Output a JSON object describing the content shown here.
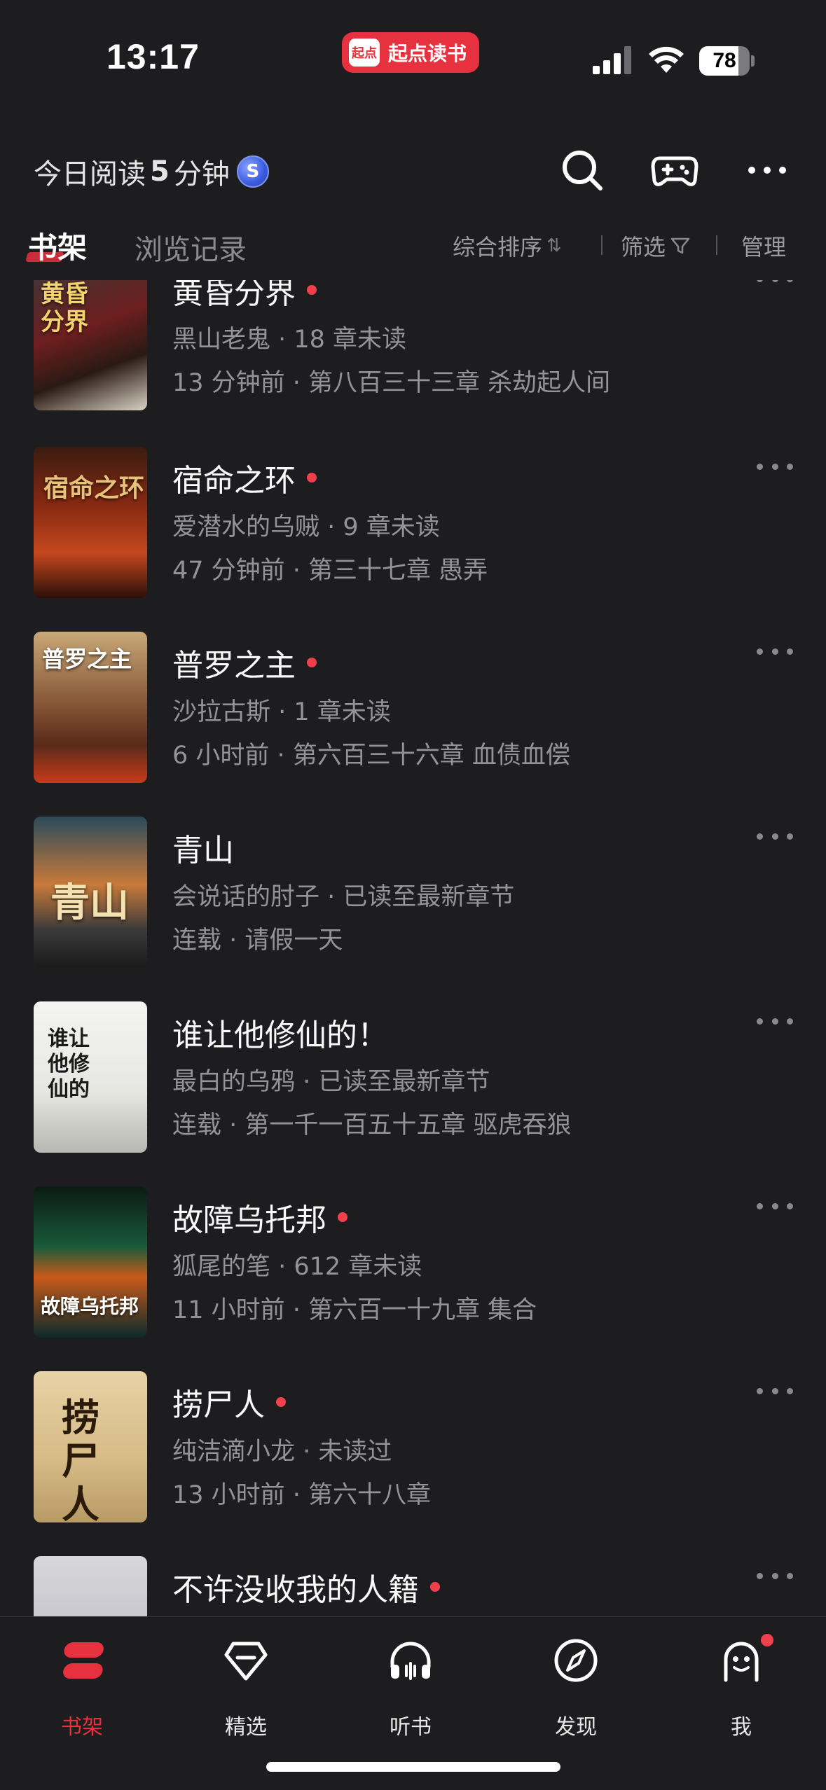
{
  "status": {
    "time": "13:17",
    "app_pill": "起点读书",
    "app_pill_logo": "起点",
    "battery": "78"
  },
  "header": {
    "reading_prefix": "今日阅读",
    "reading_value": "5",
    "reading_unit": "分钟",
    "coin_label": "S"
  },
  "tabs": {
    "active": "书架",
    "inactive": "浏览记录",
    "sort": "综合排序",
    "sort_icon": "⇅",
    "filter": "筛选",
    "manage": "管理"
  },
  "books": [
    {
      "title": "黄昏分界",
      "unread_dot": true,
      "line1": "黑山老鬼 · 18 章未读",
      "line2": "13 分钟前 · 第八百三十三章 杀劫起人间",
      "cover_text": "黄昏分界"
    },
    {
      "title": "宿命之环",
      "unread_dot": true,
      "line1": "爱潜水的乌贼 · 9 章未读",
      "line2": "47 分钟前 · 第三十七章 愚弄",
      "cover_text": "宿命之环"
    },
    {
      "title": "普罗之主",
      "unread_dot": true,
      "line1": "沙拉古斯 · 1 章未读",
      "line2": "6 小时前 · 第六百三十六章 血债血偿",
      "cover_text": "普罗之主"
    },
    {
      "title": "青山",
      "unread_dot": false,
      "line1": "会说话的肘子 · 已读至最新章节",
      "line2": "连载 · 请假一天",
      "cover_text": "青山"
    },
    {
      "title": "谁让他修仙的！",
      "unread_dot": false,
      "line1": "最白的乌鸦 · 已读至最新章节",
      "line2": "连载 · 第一千一百五十五章 驱虎吞狼",
      "cover_text": "谁让他修仙的"
    },
    {
      "title": "故障乌托邦",
      "unread_dot": true,
      "line1": "狐尾的笔 · 612 章未读",
      "line2": "11 小时前 · 第六百一十九章 集合",
      "cover_text": "故障乌托邦"
    },
    {
      "title": "捞尸人",
      "unread_dot": true,
      "line1": "纯洁滴小龙 · 未读过",
      "line2": "13 小时前 · 第六十八章",
      "cover_text": "捞尸人"
    },
    {
      "title": "不许没收我的人籍",
      "unread_dot": true,
      "line1": "",
      "line2": "",
      "cover_text": ""
    }
  ],
  "tabbar": [
    {
      "label": "书架",
      "icon": "bookshelf-icon",
      "active": true
    },
    {
      "label": "精选",
      "icon": "diamond-icon",
      "active": false
    },
    {
      "label": "听书",
      "icon": "headphones-icon",
      "active": false
    },
    {
      "label": "发现",
      "icon": "compass-icon",
      "active": false
    },
    {
      "label": "我",
      "icon": "profile-icon",
      "active": false
    }
  ],
  "colors": {
    "accent": "#e8313f",
    "background": "#1d1d1f",
    "muted_text": "#949498"
  }
}
